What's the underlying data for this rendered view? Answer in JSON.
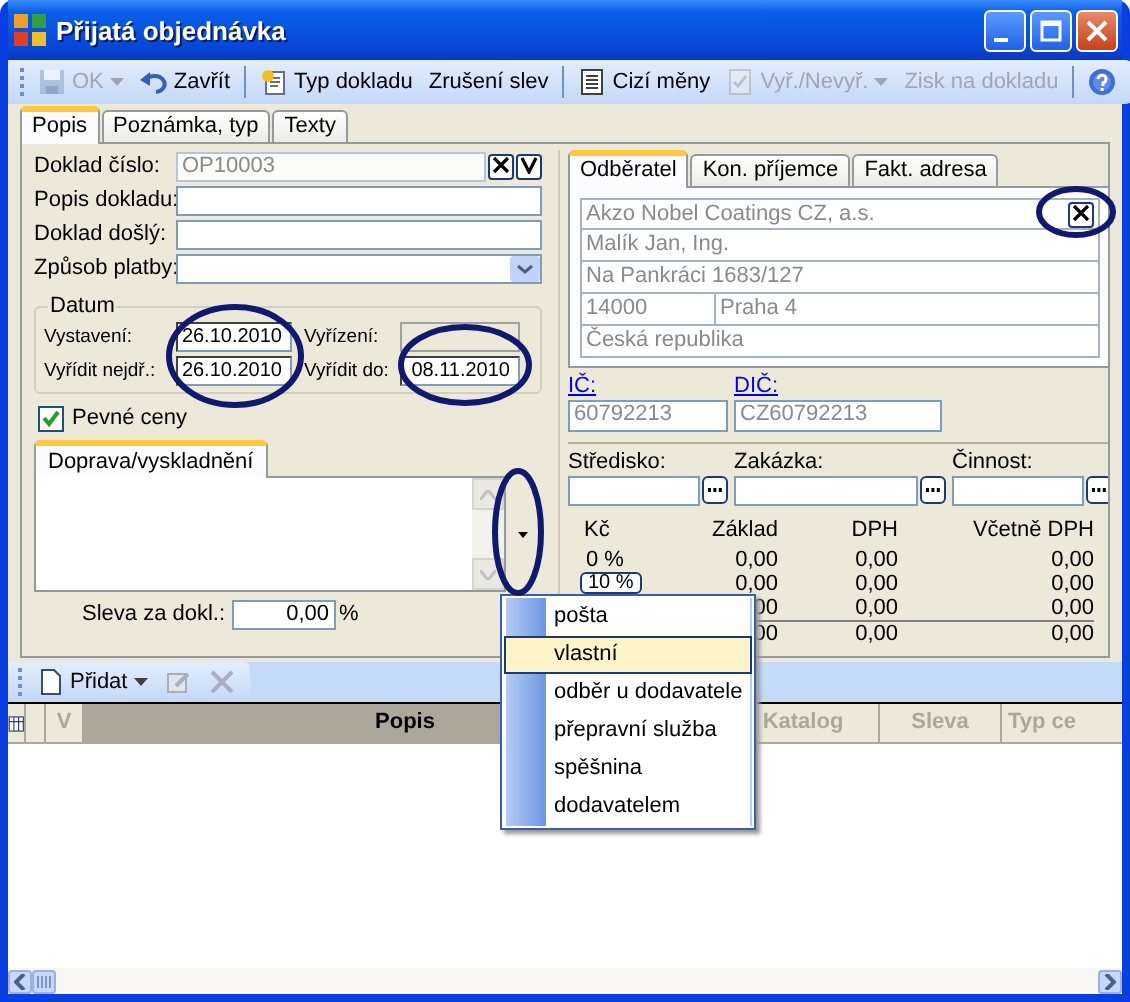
{
  "window": {
    "title": "Přijatá objednávka"
  },
  "toolbar": [
    {
      "kind": "button",
      "label": "OK",
      "disabled": true,
      "dropdown": true
    },
    {
      "kind": "button",
      "label": "Zavřít",
      "disabled": false,
      "dropdown": false
    },
    {
      "kind": "separator"
    },
    {
      "kind": "button",
      "label": "Typ dokladu",
      "disabled": false,
      "dropdown": false
    },
    {
      "kind": "button",
      "label": "Zrušení slev",
      "disabled": false,
      "dropdown": false
    },
    {
      "kind": "separator"
    },
    {
      "kind": "button",
      "label": "Cizí měny",
      "disabled": false,
      "dropdown": false
    },
    {
      "kind": "button",
      "label": "Vyř./Nevyř.",
      "disabled": true,
      "dropdown": true
    },
    {
      "kind": "button",
      "label": "Zisk na dokladu",
      "disabled": true,
      "dropdown": false
    },
    {
      "kind": "separator"
    },
    {
      "kind": "help"
    }
  ],
  "tabs": [
    {
      "label": "Popis",
      "selected": true
    },
    {
      "label": "Poznámka, typ",
      "selected": false
    },
    {
      "label": "Texty",
      "selected": false
    }
  ],
  "document_fields": [
    {
      "label": "Doklad číslo:",
      "value": "OP10003",
      "disabled": true,
      "kind": "lookup"
    },
    {
      "label": "Popis dokladu:",
      "disabled": false,
      "kind": "text"
    },
    {
      "label": "Doklad došlý:",
      "disabled": false,
      "kind": "text"
    },
    {
      "label": "Způsob platby:",
      "disabled": false,
      "kind": "select"
    }
  ],
  "date_group": {
    "title": "Datum",
    "fields": [
      {
        "label": "Vystavení:",
        "value": "26.10.2010",
        "disabled": false
      },
      {
        "label": "Vyřízení:",
        "disabled": true
      },
      {
        "label": "Vyřídit nejdř.:",
        "value": "26.10.2010",
        "disabled": false
      },
      {
        "label": "Vyřídit do:",
        "value": "08.11.2010",
        "disabled": false
      }
    ]
  },
  "fixed_prices": {
    "label": "Pevné ceny",
    "checked": true
  },
  "shipping_tabs": [
    {
      "label": "Doprava/vyskladnění",
      "selected": true
    }
  ],
  "discount": {
    "label": "Sleva za dokl.:",
    "value": "0,00",
    "unit": "%"
  },
  "party_tabs": [
    {
      "label": "Odběratel",
      "selected": true
    },
    {
      "label": "Kon. příjemce",
      "selected": false
    },
    {
      "label": "Fakt. adresa",
      "selected": false
    }
  ],
  "address": {
    "name": "Akzo Nobel Coatings CZ, a.s.",
    "contact": "Malík Jan, Ing.",
    "street": "Na Pankráci 1683/127",
    "zip": "14000",
    "city": "Praha 4",
    "country": "Česká republika"
  },
  "ids": [
    {
      "label": "IČ:",
      "value": "60792213"
    },
    {
      "label": "DIČ:",
      "value": "CZ60792213"
    }
  ],
  "lookups": [
    {
      "label": "Středisko:"
    },
    {
      "label": "Zakázka:"
    },
    {
      "label": "Činnost:"
    }
  ],
  "vat": {
    "columns": [
      "Kč",
      "Základ",
      "DPH",
      "Včetně DPH"
    ],
    "rows": [
      {
        "kind": "text",
        "rate": "0 %",
        "values": [
          "0,00",
          "0,00",
          "0,00"
        ]
      },
      {
        "kind": "button",
        "rate": "10 %",
        "values": [
          "0,00",
          "0,00",
          "0,00"
        ]
      },
      {
        "kind": "text",
        "values": [
          "00",
          "0,00",
          "0,00"
        ]
      },
      {
        "kind": "total",
        "values": [
          "00",
          "0,00",
          "0,00"
        ]
      }
    ]
  },
  "items_toolbar": [
    {
      "kind": "add",
      "label": "Přidat",
      "disabled": false
    },
    {
      "kind": "edit",
      "disabled": true
    },
    {
      "kind": "delete",
      "disabled": true
    }
  ],
  "grid": {
    "columns": [
      {
        "label": "V",
        "sorted": false
      },
      {
        "label": "Popis",
        "sorted": true
      },
      {
        "label": "Katalog",
        "sorted": false
      },
      {
        "label": "Sleva",
        "sorted": false
      },
      {
        "label": "Typ ce",
        "sorted": false
      }
    ]
  },
  "dropdown_menu": [
    {
      "label": "pošta",
      "selected": false
    },
    {
      "label": "vlastní",
      "selected": true
    },
    {
      "label": "odběr u dodavatele",
      "selected": false
    },
    {
      "label": "přepravní služba",
      "selected": false
    },
    {
      "label": "spěšnina",
      "selected": false
    },
    {
      "label": "dodavatelem",
      "selected": false
    }
  ]
}
